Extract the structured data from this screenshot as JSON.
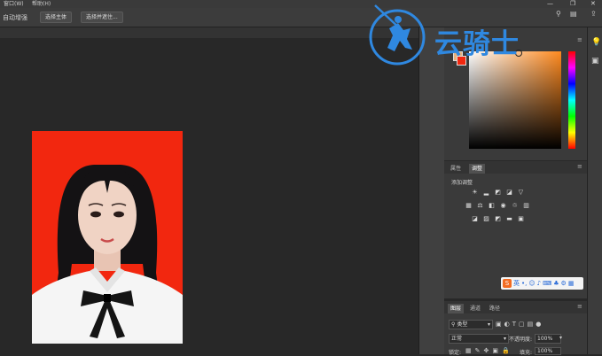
{
  "menu": {
    "window_label": "窗口(W)",
    "help_label": "帮助(H)"
  },
  "options_bar": {
    "auto_enhance_label": "自动增强",
    "select_subject_button": "选择主体",
    "select_and_mask_button": "选择并遮住..."
  },
  "watermark": {
    "text": "云骑士",
    "color": "#2f88e0"
  },
  "properties_panel": {
    "tabs": [
      "属性",
      "调整"
    ],
    "active_tab": "调整",
    "add_adjustment_label": "添加调整"
  },
  "ime_toolbar": {
    "mode_label": "英"
  },
  "layers_panel": {
    "tabs": [
      "图层",
      "通道",
      "路径"
    ],
    "active_tab": "图层",
    "filter_kind": "类型",
    "blend_mode": "正常",
    "opacity_label": "不透明度:",
    "opacity_value": "100%",
    "lock_label": "锁定:",
    "fill_label": "填充:",
    "fill_value": "100%"
  },
  "colors": {
    "foreground": "#f2270f",
    "background": "#e9b27c",
    "photo_background": "#f2270f",
    "picker_hue": "#ff8a1f"
  }
}
